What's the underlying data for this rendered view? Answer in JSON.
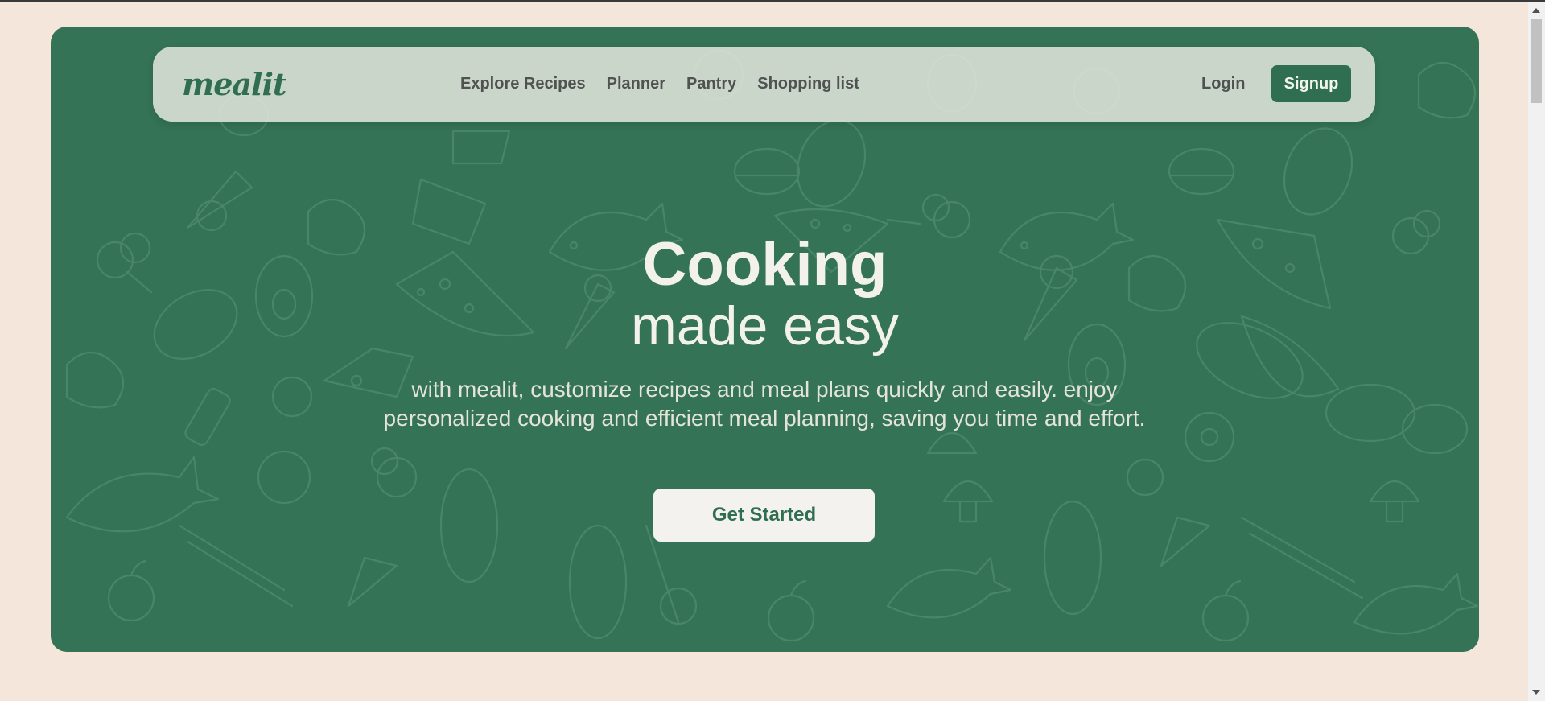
{
  "brand": {
    "logo": "mealit"
  },
  "nav": {
    "links": [
      {
        "label": "Explore Recipes"
      },
      {
        "label": "Planner"
      },
      {
        "label": "Pantry"
      },
      {
        "label": "Shopping list"
      }
    ],
    "login_label": "Login",
    "signup_label": "Signup"
  },
  "hero": {
    "headline_bold": "Cooking",
    "headline_light": "made easy",
    "subtext": "with mealit, customize recipes and meal plans quickly and easily. enjoy personalized cooking and efficient meal planning, saving you time and effort.",
    "cta_label": "Get Started",
    "background_pattern": "food-doodles"
  },
  "colors": {
    "page_background": "#f5e6dc",
    "hero_green": "#347356",
    "brand_green": "#2f6e50",
    "nav_background": "#ecece4",
    "headline_text": "#f3f1ec"
  }
}
